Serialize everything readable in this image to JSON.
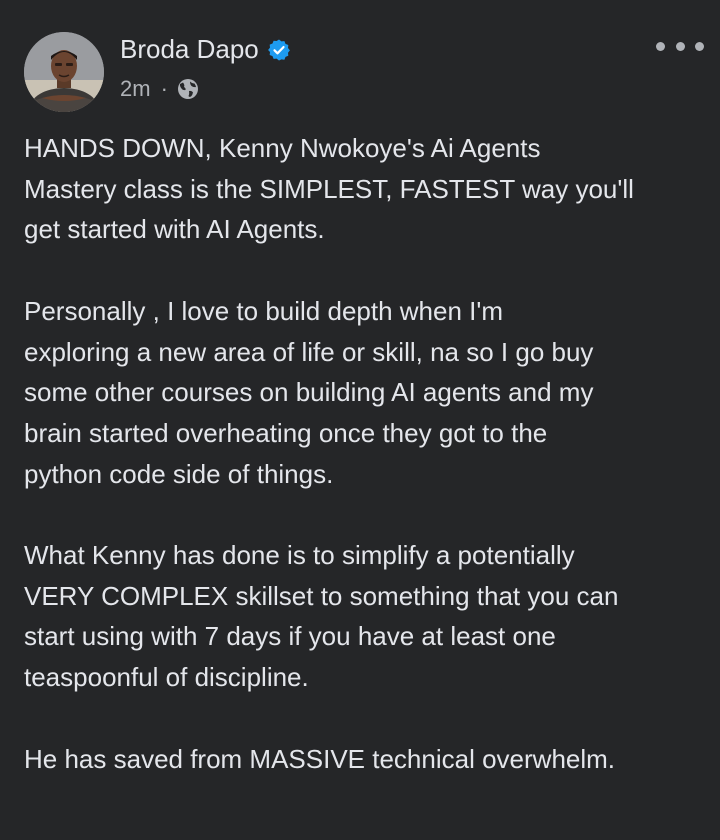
{
  "post": {
    "author": "Broda Dapo",
    "verified": true,
    "timestamp": "2m",
    "separator": "·",
    "privacy_icon": "globe-icon",
    "more_icon": "more-horizontal-icon",
    "paragraphs": [
      "HANDS DOWN, Kenny Nwokoye's Ai Agents\nMastery class is the SIMPLEST, FASTEST way you'll\nget started with AI Agents.",
      "Personally , I love to build depth when I'm\nexploring a new area of life or skill, na so I go buy\nsome other courses on building AI agents and my\nbrain started overheating once they got to the\npython code side of things.",
      "What Kenny has done is to simplify a potentially\nVERY COMPLEX skillset to something that you can\nstart using with 7 days if you have at least one\nteaspoonful of discipline.",
      "He has saved from MASSIVE technical overwhelm."
    ]
  },
  "colors": {
    "background": "#252628",
    "text_primary": "#e4e6eb",
    "text_secondary": "#b0b3b8",
    "verified_badge": "#1d9bf0"
  }
}
